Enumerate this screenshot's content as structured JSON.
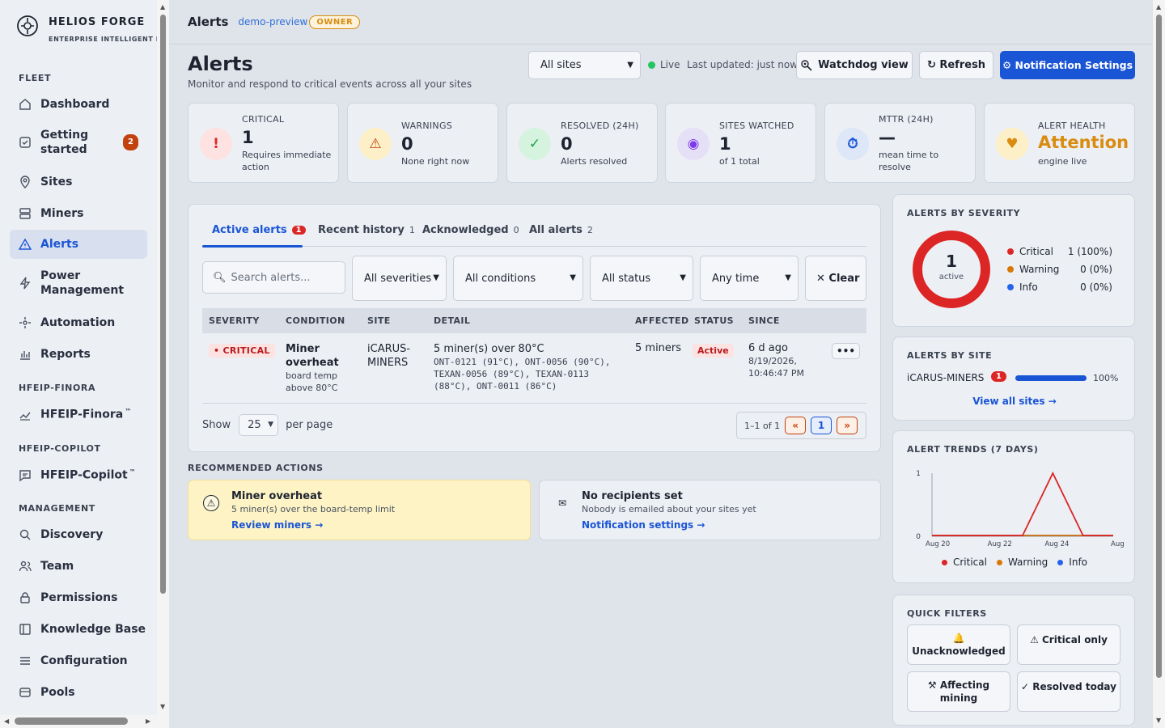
{
  "brand": {
    "name": "HELIOS FORGE",
    "subtitle": "ENTERPRISE INTELLIGENT PLATF"
  },
  "sidebar": {
    "sections": {
      "fleet": "FLEET",
      "finora": "HFEIP-FINORA",
      "copilot": "HFEIP-COPILOT",
      "management": "MANAGEMENT"
    },
    "items": {
      "dashboard": "Dashboard",
      "getting_started_1": "Getting",
      "getting_started_2": "started",
      "getting_started_badge": "2",
      "sites": "Sites",
      "miners": "Miners",
      "alerts": "Alerts",
      "power_1": "Power",
      "power_2": "Management",
      "automation": "Automation",
      "reports": "Reports",
      "finora": "HFEIP-Finora",
      "copilot": "HFEIP-Copilot",
      "tm": "™",
      "discovery": "Discovery",
      "team": "Team",
      "permissions": "Permissions",
      "knowledge": "Knowledge Base",
      "configuration": "Configuration",
      "pools": "Pools"
    }
  },
  "topbar": {
    "title": "Alerts",
    "tenant": "demo-preview",
    "role": "OWNER"
  },
  "header": {
    "title": "Alerts",
    "subtitle": "Monitor and respond to critical events across all your sites",
    "site_select": "All sites",
    "live": "Live",
    "last_updated": "Last updated: just now",
    "watchdog": "Watchdog view",
    "refresh": "↻ Refresh",
    "notif": "⚙ Notification Settings"
  },
  "stats": {
    "critical": {
      "label": "CRITICAL",
      "value": "1",
      "sub": "Requires immediate action",
      "icon": "!"
    },
    "warnings": {
      "label": "WARNINGS",
      "value": "0",
      "sub": "None right now",
      "icon": "⚠"
    },
    "resolved": {
      "label": "RESOLVED (24H)",
      "value": "0",
      "sub": "Alerts resolved",
      "icon": "✓"
    },
    "sites": {
      "label": "SITES WATCHED",
      "value": "1",
      "sub": "of 1 total",
      "icon": "◉"
    },
    "mttr": {
      "label": "MTTR (24H)",
      "value": "—",
      "sub": "mean time to resolve",
      "icon": "⏱"
    },
    "health": {
      "label": "ALERT HEALTH",
      "value": "Attention",
      "sub": "engine live",
      "icon": "♥"
    }
  },
  "tabs": {
    "active": {
      "label": "Active alerts",
      "count": "1"
    },
    "recent": {
      "label": "Recent history",
      "count": "1"
    },
    "ack": {
      "label": "Acknowledged",
      "count": "0"
    },
    "all": {
      "label": "All alerts",
      "count": "2"
    }
  },
  "filters": {
    "search_placeholder": "Search alerts...",
    "severity": "All severities",
    "condition": "All conditions",
    "status": "All status",
    "time": "Any time",
    "clear": "✕ Clear"
  },
  "table": {
    "headers": {
      "severity": "SEVERITY",
      "condition": "CONDITION",
      "site": "SITE",
      "detail": "DETAIL",
      "affected": "AFFECTED",
      "status": "STATUS",
      "since": "SINCE"
    },
    "rows": [
      {
        "severity": "• CRITICAL",
        "condition_1": "Miner",
        "condition_2": "overheat",
        "condition_sub_1": "board temp",
        "condition_sub_2": "above 80°C",
        "site_1": "iCARUS-",
        "site_2": "MINERS",
        "detail": "5 miner(s) over 80°C",
        "detail_mono_1": "ONT-0121 (91°C), ONT-0056 (90°C),",
        "detail_mono_2": "TEXAN-0056 (89°C), TEXAN-0113",
        "detail_mono_3": "(88°C), ONT-0011 (86°C)",
        "affected": "5 miners",
        "status": "Active",
        "since_1": "6 d ago",
        "since_2": "8/19/2026,",
        "since_3": "10:46:47 PM",
        "more": "•••"
      }
    ]
  },
  "pagination": {
    "show": "Show",
    "per_page_value": "25",
    "per_page": "per page",
    "range": "1–1 of 1",
    "prev": "«",
    "page": "1",
    "next": "»"
  },
  "recommended": {
    "title": "RECOMMENDED ACTIONS",
    "cards": [
      {
        "title": "Miner overheat",
        "desc": "5 miner(s) over the board-temp limit",
        "link": "Review miners →",
        "icon": "⚠"
      },
      {
        "title": "No recipients set",
        "desc": "Nobody is emailed about your sites yet",
        "link": "Notification settings →",
        "icon": "✉"
      }
    ]
  },
  "severity_panel": {
    "title": "ALERTS BY SEVERITY",
    "center_value": "1",
    "center_label": "active",
    "rows": [
      {
        "name": "Critical",
        "value": "1 (100%)",
        "color": "#dc2626"
      },
      {
        "name": "Warning",
        "value": "0 (0%)",
        "color": "#d97706"
      },
      {
        "name": "Info",
        "value": "0 (0%)",
        "color": "#2563eb"
      }
    ]
  },
  "site_panel": {
    "title": "ALERTS BY SITE",
    "site": "iCARUS-MINERS",
    "count": "1",
    "pct": "100%",
    "fraction": 1.0,
    "link": "View all sites →"
  },
  "trends": {
    "title": "ALERT TRENDS (7 DAYS)",
    "chart_data": {
      "type": "line",
      "x_labels": [
        "Aug 20",
        "Aug 22",
        "Aug 24",
        "Aug"
      ],
      "y_ticks": [
        "0",
        "1"
      ],
      "ylim": [
        0,
        1
      ],
      "series": [
        {
          "name": "Critical",
          "color": "#dc2626",
          "values": [
            0,
            0,
            0,
            0,
            1,
            0,
            0
          ]
        },
        {
          "name": "Warning",
          "color": "#d97706",
          "values": [
            0,
            0,
            0,
            0,
            0,
            0,
            0
          ]
        },
        {
          "name": "Info",
          "color": "#2563eb",
          "values": [
            0,
            0,
            0,
            0,
            0,
            0,
            0
          ]
        }
      ]
    }
  },
  "quick_filters": {
    "title": "QUICK FILTERS",
    "unack_icon": "🔔",
    "unack": "Unacknowledged",
    "critical": "⚠ Critical only",
    "mining_1": "⚒ Affecting",
    "mining_2": "mining",
    "resolved": "✓ Resolved today"
  },
  "colors": {
    "accent": "#1a55d6",
    "critical": "#dc2626",
    "warning": "#d97706",
    "owner": "#d98c10"
  }
}
